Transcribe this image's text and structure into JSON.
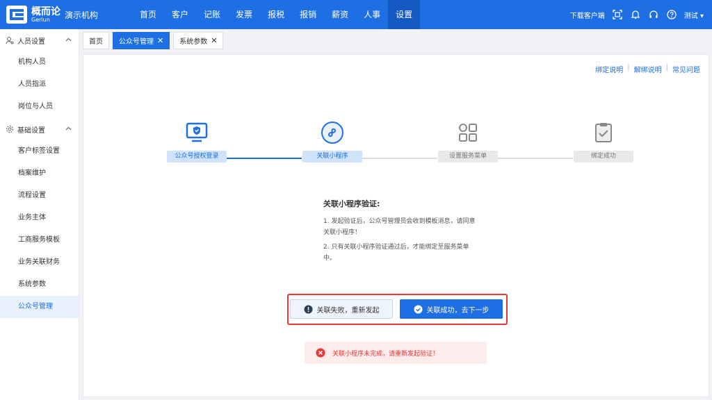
{
  "brand": {
    "name": "概而论",
    "sub": "Gerlun",
    "org": "演示机构"
  },
  "nav": [
    "首页",
    "客户",
    "记账",
    "发票",
    "报税",
    "报销",
    "薪资",
    "人事",
    "设置"
  ],
  "header_right": {
    "download": "下载客户端",
    "user": "测试"
  },
  "sidebar": {
    "groups": [
      {
        "label": "人员设置",
        "items": [
          "机构人员",
          "人员指派",
          "岗位与人员"
        ]
      },
      {
        "label": "基础设置",
        "items": [
          "客户标签设置",
          "档案维护",
          "流程设置",
          "业务主体",
          "工商服务模板",
          "业务关联财务",
          "系统参数",
          "公众号管理"
        ]
      }
    ],
    "active": "公众号管理"
  },
  "tabs": [
    {
      "label": "首页"
    },
    {
      "label": "公众号管理",
      "close": "✕"
    },
    {
      "label": "系统参数",
      "close": "✕"
    }
  ],
  "links": [
    "绑定说明",
    "|",
    "解绑说明",
    "|",
    "常见问题"
  ],
  "steps": [
    {
      "label": "公众号授权登录",
      "status": "done",
      "icon": "monitor-shield-icon"
    },
    {
      "label": "关联小程序",
      "status": "current",
      "icon": "mini-program-icon"
    },
    {
      "label": "设置服务菜单",
      "status": "todo",
      "icon": "grid-menu-icon"
    },
    {
      "label": "绑定成功",
      "status": "todo",
      "icon": "clipboard-check-icon"
    }
  ],
  "tips": {
    "title": "关联小程序验证:",
    "lines": [
      "1. 发起验证后，公众号管理员会收到模板消息，请同意关联小程序！",
      "2. 只有关联小程序验证通过后，才能绑定至服务菜单中。"
    ]
  },
  "buttons": {
    "fail": "关联失败，重新发起",
    "ok": "关联成功，去下一步"
  },
  "error": "关联小程序未完成，请重新发起验证！",
  "colors": {
    "primary": "#1e6fe3",
    "danger": "#e53935"
  }
}
